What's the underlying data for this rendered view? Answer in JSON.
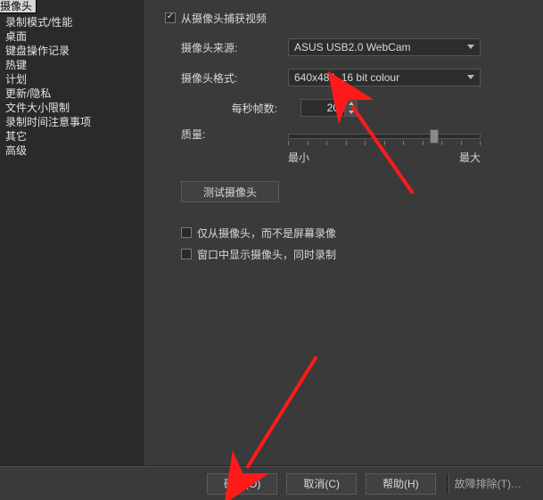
{
  "sidebar": {
    "title": "摄像头",
    "items": [
      "录制模式/性能",
      "桌面",
      "键盘操作记录",
      "热键",
      "计划",
      "更新/隐私",
      "文件大小限制",
      "录制时间注意事项",
      "其它",
      "高级"
    ]
  },
  "main": {
    "capture_checkbox_label": "从摄像头捕获视频",
    "source_label": "摄像头来源:",
    "source_value": "ASUS USB2.0 WebCam",
    "format_label": "摄像头格式:",
    "format_value": "640x480, 16 bit colour",
    "fps_label": "每秒帧数:",
    "fps_value": "20",
    "quality_label": "质量:",
    "quality_min": "最小",
    "quality_max": "最大",
    "test_button": "测试摄像头",
    "only_cam_label": "仅从摄像头，而不是屏幕录像",
    "show_in_window_label": "窗口中显示摄像头，同时录制"
  },
  "buttons": {
    "ok": "确定(O)",
    "cancel": "取消(C)",
    "help": "帮助(H)",
    "troubleshoot": "故障排除(T)…"
  }
}
